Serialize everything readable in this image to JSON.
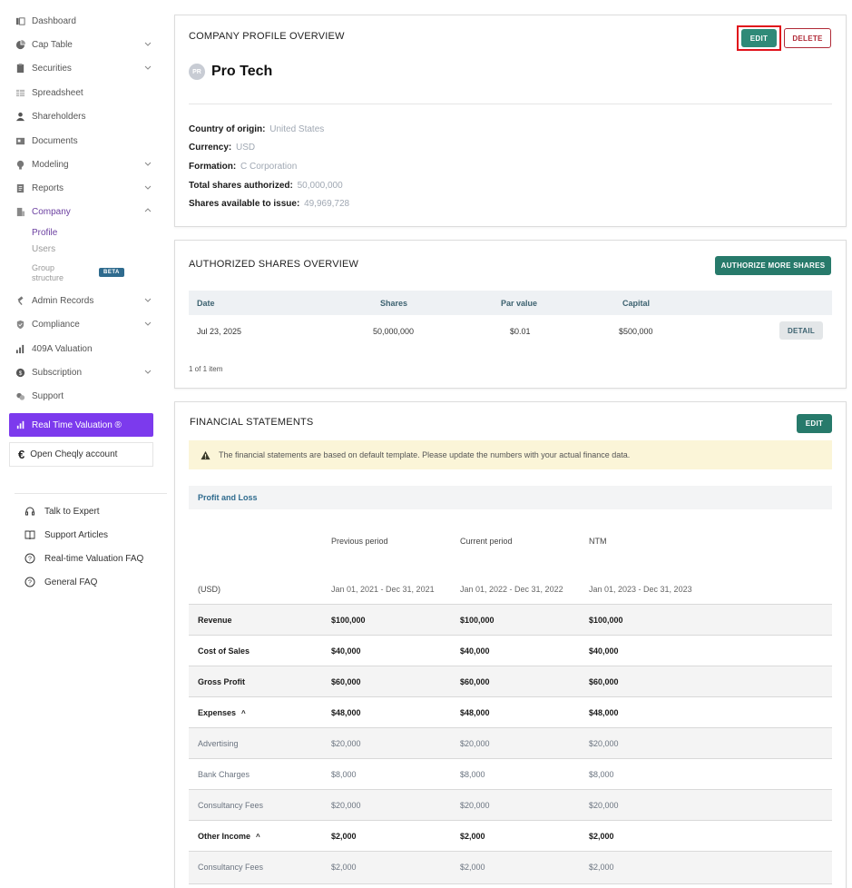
{
  "sidebar": {
    "nav": [
      {
        "label": "Dashboard",
        "icon": "dashboard-icon"
      },
      {
        "label": "Cap Table",
        "icon": "pie-chart-icon"
      },
      {
        "label": "Securities",
        "icon": "clipboard-icon"
      },
      {
        "label": "Spreadsheet",
        "icon": "spreadsheet-icon"
      },
      {
        "label": "Shareholders",
        "icon": "person-icon"
      },
      {
        "label": "Documents",
        "icon": "folder-icon"
      },
      {
        "label": "Modeling",
        "icon": "lightbulb-icon"
      },
      {
        "label": "Reports",
        "icon": "report-icon"
      },
      {
        "label": "Company",
        "icon": "building-icon"
      },
      {
        "label": "Admin Records",
        "icon": "gavel-icon"
      },
      {
        "label": "Compliance",
        "icon": "shield-check-icon"
      },
      {
        "label": "409A Valuation",
        "icon": "bar-chart-icon"
      },
      {
        "label": "Subscription",
        "icon": "dollar-circle-icon"
      },
      {
        "label": "Support",
        "icon": "support-chat-icon"
      }
    ],
    "company_sub": {
      "profile": "Profile",
      "users": "Users",
      "group_line1": "Group",
      "group_line2": "structure",
      "beta": "BETA"
    },
    "rtv_label": "Real Time Valuation ®",
    "cheqly_label": "Open Cheqly account",
    "help": [
      {
        "label": "Talk to Expert"
      },
      {
        "label": "Support Articles"
      },
      {
        "label": "Real-time Valuation FAQ"
      },
      {
        "label": "General FAQ"
      }
    ]
  },
  "profile": {
    "title": "COMPANY PROFILE OVERVIEW",
    "edit": "EDIT",
    "delete": "DELETE",
    "avatar": "PR",
    "name": "Pro Tech",
    "fields": [
      {
        "label": "Country of origin:",
        "value": "United States"
      },
      {
        "label": "Currency:",
        "value": "USD"
      },
      {
        "label": "Formation:",
        "value": "C Corporation"
      },
      {
        "label": "Total shares authorized:",
        "value": "50,000,000"
      },
      {
        "label": "Shares available to issue:",
        "value": "49,969,728"
      }
    ]
  },
  "authorized": {
    "title": "AUTHORIZED SHARES OVERVIEW",
    "authorize_btn": "AUTHORIZE MORE SHARES",
    "headers": [
      "Date",
      "Shares",
      "Par value",
      "Capital"
    ],
    "row": {
      "date": "Jul 23, 2025",
      "shares": "50,000,000",
      "par": "$0.01",
      "capital": "$500,000",
      "detail": "DETAIL"
    },
    "count": "1 of 1 item"
  },
  "financial": {
    "title": "FINANCIAL STATEMENTS",
    "edit": "EDIT",
    "warning": "The financial statements are based on default template. Please update the numbers with your actual finance data.",
    "section": "Profit and Loss",
    "columns": [
      "Previous period",
      "Current period",
      "NTM"
    ],
    "currency": "(USD)",
    "periods": [
      "Jan 01, 2021 - Dec 31, 2021",
      "Jan 01, 2022 - Dec 31, 2022",
      "Jan 01, 2023 - Dec 31, 2023"
    ],
    "rows": [
      {
        "label": "Revenue",
        "v": [
          "$100,000",
          "$100,000",
          "$100,000"
        ]
      },
      {
        "label": "Cost of Sales",
        "v": [
          "$40,000",
          "$40,000",
          "$40,000"
        ]
      },
      {
        "label": "Gross Profit",
        "v": [
          "$60,000",
          "$60,000",
          "$60,000"
        ]
      },
      {
        "label": "Expenses",
        "v": [
          "$48,000",
          "$48,000",
          "$48,000"
        ]
      },
      {
        "label": "Advertising",
        "v": [
          "$20,000",
          "$20,000",
          "$20,000"
        ]
      },
      {
        "label": "Bank Charges",
        "v": [
          "$8,000",
          "$8,000",
          "$8,000"
        ]
      },
      {
        "label": "Consultancy Fees",
        "v": [
          "$20,000",
          "$20,000",
          "$20,000"
        ]
      },
      {
        "label": "Other Income",
        "v": [
          "$2,000",
          "$2,000",
          "$2,000"
        ]
      },
      {
        "label": "Consultancy Fees",
        "v": [
          "$2,000",
          "$2,000",
          "$2,000"
        ]
      }
    ]
  },
  "colors": {
    "accent": "#2f8a78",
    "brand_purple": "#7c3aed",
    "danger": "#b02a37",
    "highlight": "#e0121b"
  }
}
